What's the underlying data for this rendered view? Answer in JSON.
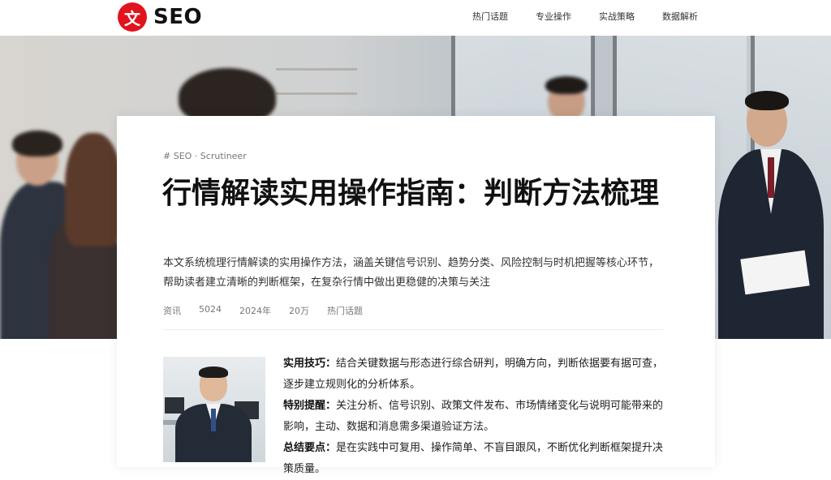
{
  "header": {
    "logo_mark": "文",
    "logo_text": "SEO",
    "nav": [
      {
        "label": "热门话题"
      },
      {
        "label": "专业操作"
      },
      {
        "label": "实战策略"
      },
      {
        "label": "数据解析"
      }
    ]
  },
  "article": {
    "source": "# SEO · Scrutineer",
    "title": "行情解读实用操作指南：判断方法梳理",
    "summary": "本文系统梳理行情解读的实用操作方法，涵盖关键信号识别、趋势分类、风险控制与时机把握等核心环节，帮助读者建立清晰的判断框架，在复杂行情中做出更稳健的决策与关注",
    "meta": [
      "资讯",
      "5024",
      "2024年",
      "20万",
      "热门话题"
    ],
    "points": [
      {
        "label": "实用技巧：",
        "text": "结合关键数据与形态进行综合研判，明确方向，判断依据要有据可查，逐步建立规则化的分析体系。"
      },
      {
        "label": "特别提醒：",
        "text": "关注分析、信号识别、政策文件发布、市场情绪变化与说明可能带来的影响，主动、数据和消息需多渠道验证方法。"
      },
      {
        "label": "总结要点：",
        "text": "是在实践中可复用、操作简单、不盲目跟风，不断优化判断框架提升决策质量。"
      }
    ]
  },
  "colors": {
    "brand_red": "#e1141e",
    "title_text": "#111111",
    "muted_text": "#777777"
  }
}
